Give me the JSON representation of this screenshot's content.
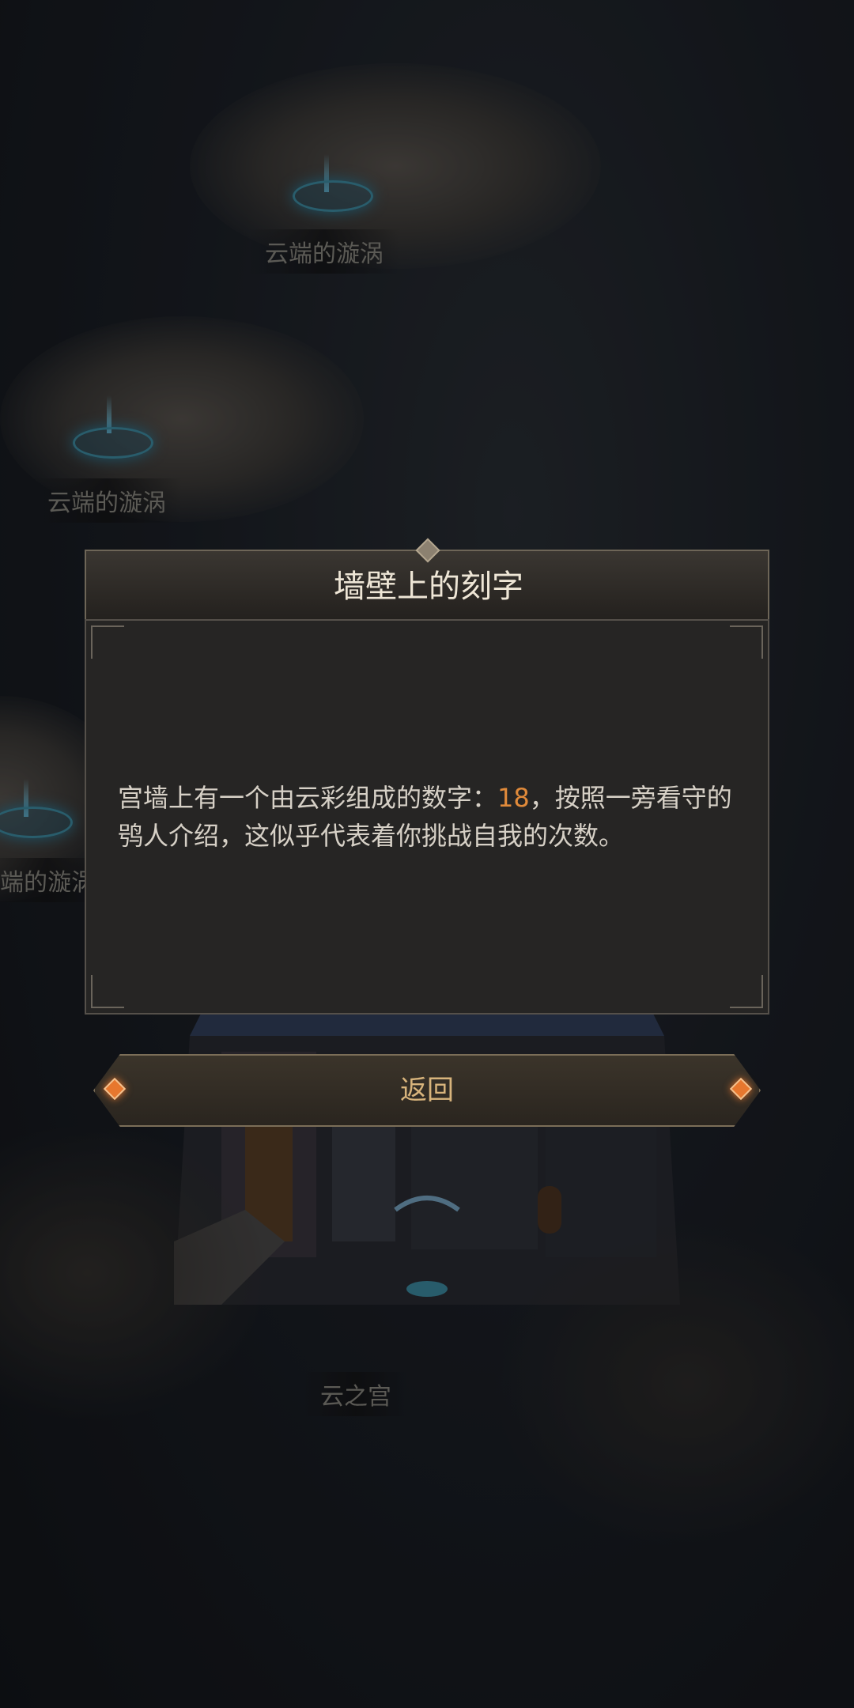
{
  "map": {
    "labels": {
      "vortex_top": "云端的漩涡",
      "vortex_mid": "云端的漩涡",
      "vortex_left": "端的漩涡",
      "palace": "云之宫"
    }
  },
  "dialog": {
    "title": "墙壁上的刻字",
    "text_before": "宫墙上有一个由云彩组成的数字：",
    "number": "18",
    "text_after": "，按照一旁看守的鸮人介绍，这似乎代表着你挑战自我的次数。"
  },
  "buttons": {
    "back": "返回"
  },
  "colors": {
    "accent_number": "#e08a3a",
    "button_text": "#d8b47c"
  }
}
